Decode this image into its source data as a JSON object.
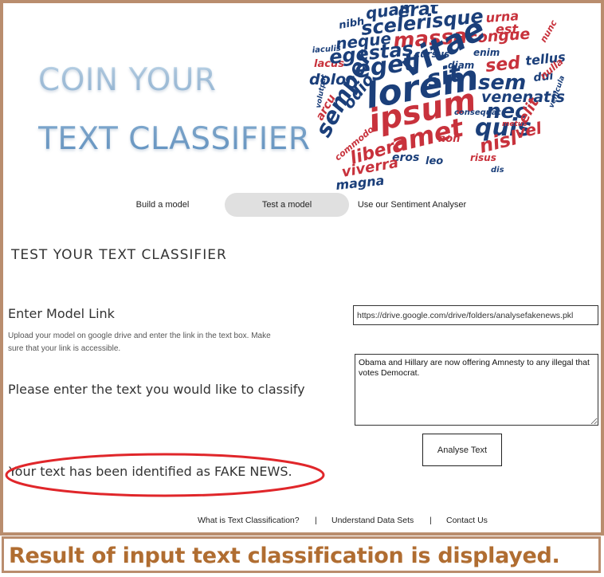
{
  "logo": {
    "line1": "COIN YOUR",
    "line2": "TEXT CLASSIFIER"
  },
  "wordcloud": {
    "words": [
      {
        "text": "quam",
        "color": "#1b3f7a"
      },
      {
        "text": "erat",
        "color": "#1b3f7a"
      },
      {
        "text": "urna",
        "color": "#c8323c"
      },
      {
        "text": "nibh",
        "color": "#1b3f7a"
      },
      {
        "text": "scelerisque",
        "color": "#1b3f7a"
      },
      {
        "text": "est",
        "color": "#c8323c"
      },
      {
        "text": "neque",
        "color": "#1b3f7a"
      },
      {
        "text": "massa",
        "color": "#c8323c"
      },
      {
        "text": "congue",
        "color": "#c8323c"
      },
      {
        "text": "lacus",
        "color": "#c8323c"
      },
      {
        "text": "egestas",
        "color": "#1b3f7a"
      },
      {
        "text": "enim",
        "color": "#1b3f7a"
      },
      {
        "text": "eget",
        "color": "#1b3f7a"
      },
      {
        "text": "vitae",
        "color": "#1b3f7a"
      },
      {
        "text": "sed",
        "color": "#c8323c"
      },
      {
        "text": "tellus",
        "color": "#1b3f7a"
      },
      {
        "text": "dolor",
        "color": "#1b3f7a"
      },
      {
        "text": "sit",
        "color": "#1b3f7a"
      },
      {
        "text": "sem",
        "color": "#1b3f7a"
      },
      {
        "text": "dui",
        "color": "#1b3f7a"
      },
      {
        "text": "venenatis",
        "color": "#1b3f7a"
      },
      {
        "text": "odio",
        "color": "#1b3f7a"
      },
      {
        "text": "lorem",
        "color": "#1b3f7a"
      },
      {
        "text": "nec",
        "color": "#1b3f7a"
      },
      {
        "text": "semper",
        "color": "#1b3f7a"
      },
      {
        "text": "ipsum",
        "color": "#c8323c"
      },
      {
        "text": "quis",
        "color": "#1b3f7a"
      },
      {
        "text": "elit",
        "color": "#c8323c"
      },
      {
        "text": "arcu",
        "color": "#c8323c"
      },
      {
        "text": "amet",
        "color": "#c8323c"
      },
      {
        "text": "vel",
        "color": "#c8323c"
      },
      {
        "text": "nisl",
        "color": "#c8323c"
      },
      {
        "text": "non",
        "color": "#c8323c"
      },
      {
        "text": "libero",
        "color": "#c8323c"
      },
      {
        "text": "eros",
        "color": "#1b3f7a"
      },
      {
        "text": "leo",
        "color": "#1b3f7a"
      },
      {
        "text": "risus",
        "color": "#c8323c"
      },
      {
        "text": "viverra",
        "color": "#c8323c"
      },
      {
        "text": "magna",
        "color": "#1b3f7a"
      },
      {
        "text": "commodo",
        "color": "#c8323c"
      },
      {
        "text": "iaculis",
        "color": "#1b3f7a"
      },
      {
        "text": "cursus",
        "color": "#1b3f7a"
      },
      {
        "text": "diam",
        "color": "#1b3f7a"
      },
      {
        "text": "nulla",
        "color": "#c8323c"
      },
      {
        "text": "volutpat",
        "color": "#1b3f7a"
      },
      {
        "text": "consequat",
        "color": "#1b3f7a"
      },
      {
        "text": "nunc",
        "color": "#c8323c"
      },
      {
        "text": "metus",
        "color": "#c8323c"
      },
      {
        "text": "vehicula",
        "color": "#1b3f7a"
      },
      {
        "text": "dis",
        "color": "#1b3f7a"
      }
    ]
  },
  "nav": {
    "items": [
      {
        "label": "Build a  model",
        "active": false
      },
      {
        "label": "Test a model",
        "active": true
      },
      {
        "label": "Use our Sentiment Analyser",
        "active": false
      }
    ]
  },
  "main": {
    "title": "TEST YOUR TEXT CLASSIFIER",
    "model_link_label": "Enter Model Link",
    "model_link_help": "Upload your model on google drive and enter the link in the text box.  Make sure that your link is accessible.",
    "model_link_value": "https://drive.google.com/drive/folders/analysefakenews.pkl",
    "text_label": "Please enter the text you would like to classify",
    "text_value": "Obama and Hillary are now offering Amnesty to any illegal that votes Democrat.",
    "analyse_button": "Analyse Text",
    "result_prefix": "Your text has been identified as ",
    "result_value": "FAKE NEWS."
  },
  "footer": {
    "links": [
      "What is Text Classification?",
      "Understand Data Sets",
      "Contact Us"
    ],
    "separator": "|"
  },
  "annotation": {
    "caption": "Result of input text classification is displayed.",
    "highlight_color": "#e0262a",
    "frame_color": "#b98d6e",
    "caption_color": "#b06d31"
  }
}
